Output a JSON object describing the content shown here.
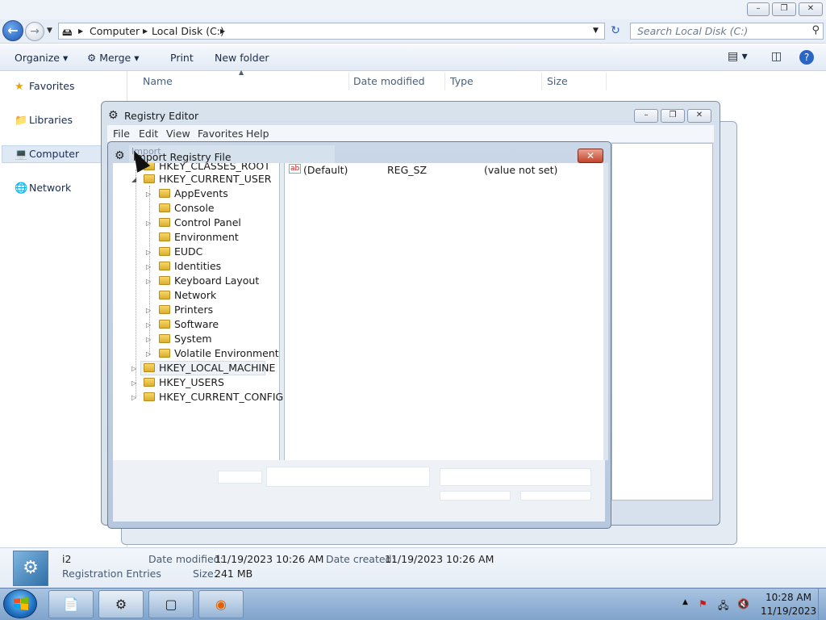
{
  "explorer": {
    "caption_buttons": [
      "–",
      "❐",
      "✕"
    ],
    "breadcrumb": [
      "Computer",
      "Local Disk (C:)"
    ],
    "search_placeholder": "Search Local Disk (C:)",
    "toolbar": {
      "organize": "Organize",
      "merge": "Merge",
      "print": "Print",
      "new_folder": "New folder"
    },
    "sidebar": {
      "favorites": "Favorites",
      "libraries": "Libraries",
      "computer": "Computer",
      "network": "Network"
    },
    "columns": [
      "Name",
      "Date modified",
      "Type",
      "Size"
    ],
    "details": {
      "name": "i2",
      "type": "Registration Entries",
      "date_modified_label": "Date modified:",
      "date_modified": "11/19/2023 10:26 AM",
      "date_created_label": "Date created:",
      "date_created": "11/19/2023 10:26 AM",
      "size_label": "Size:",
      "size": "241 MB"
    }
  },
  "registry_editor": {
    "title": "Registry Editor",
    "menu": [
      "File",
      "Edit",
      "View",
      "Favorites",
      "Help"
    ]
  },
  "import_dialog": {
    "title": "Import Registry File",
    "ghost_title": "Import",
    "close": "✕",
    "tree": {
      "hkcr": "HKEY_CLASSES_ROOT",
      "hkcu": "HKEY_CURRENT_USER",
      "children": [
        "AppEvents",
        "Console",
        "Control Panel",
        "Environment",
        "EUDC",
        "Identities",
        "Keyboard Layout",
        "Network",
        "Printers",
        "Software",
        "System",
        "Volatile Environment"
      ],
      "hklm": "HKEY_LOCAL_MACHINE",
      "hku": "HKEY_USERS",
      "hkcc": "HKEY_CURRENT_CONFIG"
    },
    "value": {
      "icon": "ab",
      "name": "(Default)",
      "type": "REG_SZ",
      "data": "(value not set)"
    }
  },
  "taskbar": {
    "time": "10:28 AM",
    "date": "11/19/2023",
    "apps": [
      "file-icon",
      "regedit-icon",
      "tablet-icon",
      "firefox-icon"
    ]
  },
  "colors": {
    "taskbar": "#7fa3cc",
    "close_red": "#c2432b",
    "folder": "#dcae2e"
  }
}
